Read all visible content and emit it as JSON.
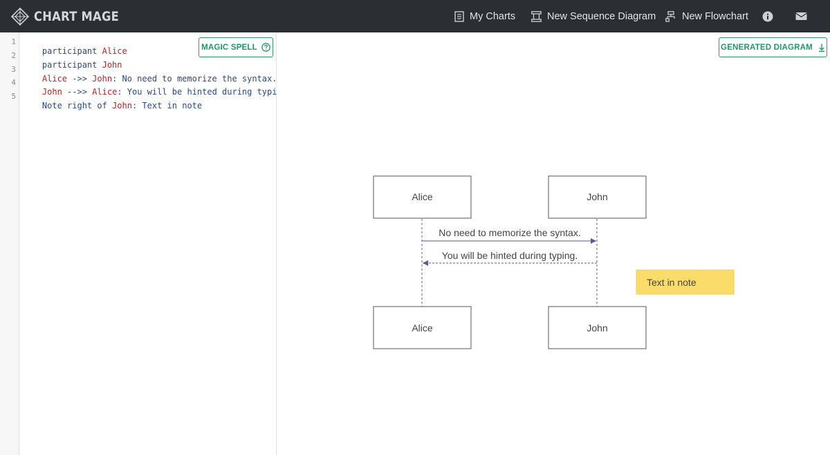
{
  "app": {
    "brand": "CHART MAGE",
    "logo_icon": "crystal-logo-icon"
  },
  "nav": {
    "items": [
      {
        "label": "My Charts",
        "icon": "document-icon"
      },
      {
        "label": "New Sequence Diagram",
        "icon": "sequence-icon"
      },
      {
        "label": "New Flowchart",
        "icon": "flowchart-icon"
      }
    ],
    "info_icon": "info-icon",
    "mail_icon": "mail-icon"
  },
  "editor": {
    "line_numbers": [
      "1",
      "2",
      "3",
      "4",
      "5"
    ],
    "lines": [
      {
        "parts": [
          {
            "text": "participant ",
            "type": "kw"
          },
          {
            "text": "Alice",
            "type": "actor"
          }
        ]
      },
      {
        "parts": [
          {
            "text": "participant ",
            "type": "kw"
          },
          {
            "text": "John",
            "type": "actor"
          }
        ]
      },
      {
        "parts": [
          {
            "text": "Alice",
            "type": "actor"
          },
          {
            "text": " ->> ",
            "type": "kw"
          },
          {
            "text": "John",
            "type": "actor"
          },
          {
            "text": ": No need to memorize the syntax.",
            "type": "kw"
          }
        ]
      },
      {
        "parts": [
          {
            "text": "John",
            "type": "actor"
          },
          {
            "text": " -->> ",
            "type": "kw"
          },
          {
            "text": "Alice",
            "type": "actor"
          },
          {
            "text": ": You will be hinted during typing.",
            "type": "kw"
          }
        ]
      },
      {
        "parts": [
          {
            "text": "Note right of ",
            "type": "kw"
          },
          {
            "text": "John",
            "type": "actor"
          },
          {
            "text": ": Text in note",
            "type": "kw"
          }
        ]
      }
    ],
    "magic_button": "MAGIC SPELL",
    "magic_icon": "help-circle-icon"
  },
  "diagram": {
    "generated_button": "GENERATED DIAGRAM",
    "download_icon": "download-icon",
    "actors": [
      "Alice",
      "John"
    ],
    "messages": [
      {
        "from": "Alice",
        "to": "John",
        "text": "No need to memorize the syntax.",
        "style": "solid"
      },
      {
        "from": "John",
        "to": "Alice",
        "text": "You will be hinted during typing.",
        "style": "dashed"
      }
    ],
    "note": {
      "position": "right of",
      "actor": "John",
      "text": "Text in note",
      "color": "#f9dc6a"
    }
  },
  "colors": {
    "navbar_bg": "#2b2e33",
    "accent_green": "#2aa06e",
    "actor_code": "#c42020",
    "code_text": "#2b4a85",
    "lifeline": "#5b5f9a"
  }
}
